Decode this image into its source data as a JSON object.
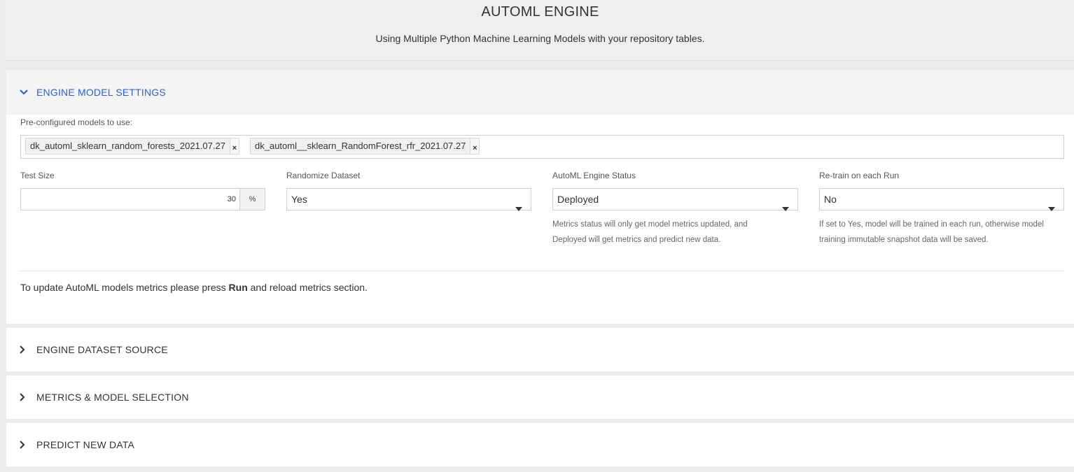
{
  "header": {
    "title": "AUTOML ENGINE",
    "subtitle": "Using Multiple Python Machine Learning Models with your repository tables."
  },
  "sections": [
    {
      "label": "ENGINE MODEL SETTINGS",
      "expanded": true
    },
    {
      "label": "ENGINE DATASET SOURCE",
      "expanded": false
    },
    {
      "label": "METRICS & MODEL SELECTION",
      "expanded": false
    },
    {
      "label": "PREDICT NEW DATA",
      "expanded": false
    }
  ],
  "settings": {
    "models_label": "Pre-configured models to use:",
    "models": [
      "dk_automl_sklearn_random_forests_2021.07.27",
      "dk_automl__sklearn_RandomForest_rfr_2021.07.27"
    ],
    "test_size_label": "Test Size",
    "test_size_value": "30",
    "test_size_unit": "%",
    "randomize_label": "Randomize Dataset",
    "randomize_value": "Yes",
    "status_label": "AutoML Engine Status",
    "status_value": "Deployed",
    "status_help_1": "Metrics status will only get model metrics updated, and",
    "status_help_2": "Deployed will get metrics and predict new data.",
    "retrain_label": "Re-train on each Run",
    "retrain_value": "No",
    "retrain_help_1": "If set to Yes, model will be trained in each run, otherwise model",
    "retrain_help_2": "training immutable snapshot data will be saved.",
    "note_prefix": "To update AutoML models metrics please press ",
    "note_bold": "Run",
    "note_suffix": " and reload metrics section."
  },
  "colors": {
    "accent": "#2a5fd9",
    "page_bg": "#ececec"
  },
  "icons": {
    "expanded": "chevron-down-icon",
    "collapsed": "chevron-right-icon",
    "remove": "close-icon",
    "dropdown": "caret-down-icon"
  }
}
